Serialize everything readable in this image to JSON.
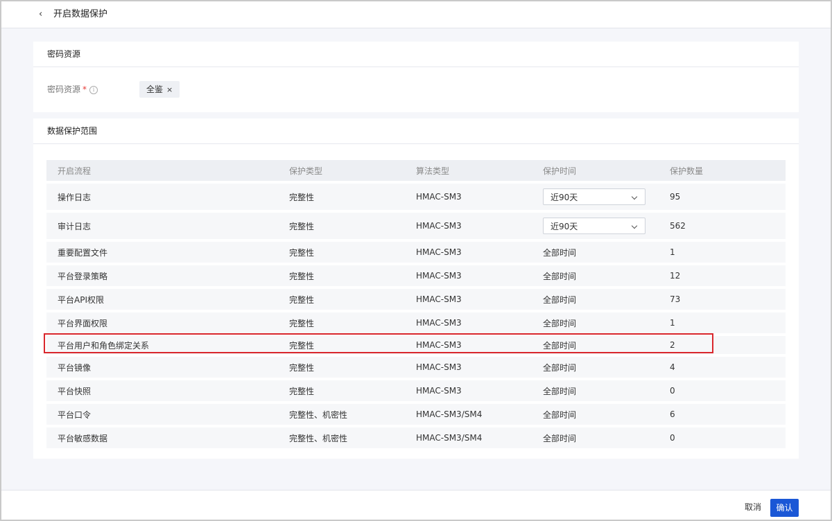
{
  "header": {
    "back_icon": "chevron-left-icon",
    "title": "开启数据保护"
  },
  "resource_section": {
    "title": "密码资源",
    "field_label": "密码资源",
    "required_mark": "*",
    "info_icon": "i",
    "tag": {
      "label": "全鉴",
      "remove": "×"
    }
  },
  "scope_section": {
    "title": "数据保护范围",
    "columns": [
      "开启流程",
      "保护类型",
      "算法类型",
      "保护时间",
      "保护数量"
    ],
    "rows": [
      {
        "process": "操作日志",
        "type": "完整性",
        "algo": "HMAC-SM3",
        "time": "近90天",
        "count": "95"
      },
      {
        "process": "审计日志",
        "type": "完整性",
        "algo": "HMAC-SM3",
        "time": "近90天",
        "count": "562"
      },
      {
        "process": "重要配置文件",
        "type": "完整性",
        "algo": "HMAC-SM3",
        "time": "全部时间",
        "count": "1"
      },
      {
        "process": "平台登录策略",
        "type": "完整性",
        "algo": "HMAC-SM3",
        "time": "全部时间",
        "count": "12"
      },
      {
        "process": "平台API权限",
        "type": "完整性",
        "algo": "HMAC-SM3",
        "time": "全部时间",
        "count": "73"
      },
      {
        "process": "平台界面权限",
        "type": "完整性",
        "algo": "HMAC-SM3",
        "time": "全部时间",
        "count": "1"
      },
      {
        "process": "平台用户和角色绑定关系",
        "type": "完整性",
        "algo": "HMAC-SM3",
        "time": "全部时间",
        "count": "2"
      },
      {
        "process": "平台镜像",
        "type": "完整性",
        "algo": "HMAC-SM3",
        "time": "全部时间",
        "count": "4"
      },
      {
        "process": "平台快照",
        "type": "完整性",
        "algo": "HMAC-SM3",
        "time": "全部时间",
        "count": "0"
      },
      {
        "process": "平台口令",
        "type": "完整性、机密性",
        "algo": "HMAC-SM3/SM4",
        "time": "全部时间",
        "count": "6"
      },
      {
        "process": "平台敏感数据",
        "type": "完整性、机密性",
        "algo": "HMAC-SM3/SM4",
        "time": "全部时间",
        "count": "0"
      }
    ]
  },
  "footer": {
    "cancel_label": "取消",
    "confirm_label": "确认"
  },
  "colors": {
    "primary": "#1a57d6",
    "highlight_border": "#d9262c",
    "required": "#e53935"
  }
}
